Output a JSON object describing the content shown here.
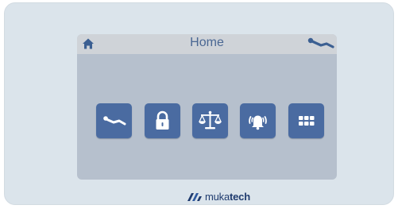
{
  "screen": {
    "title": "Home",
    "tiles": [
      {
        "icon": "recline-icon",
        "name": "recline-button"
      },
      {
        "icon": "lock-icon",
        "name": "lock-button"
      },
      {
        "icon": "scale-icon",
        "name": "scale-button"
      },
      {
        "icon": "alarm-bell-icon",
        "name": "alarm-button"
      },
      {
        "icon": "grid-menu-icon",
        "name": "menu-button"
      }
    ]
  },
  "brand": {
    "name_light": "muka",
    "name_bold": "tech"
  },
  "colors": {
    "device_bg": "#dbe4eb",
    "screen_bg": "#b6c0cd",
    "header_bg": "#cfd3d8",
    "accent": "#4a6ba1",
    "title_text": "#4a6793",
    "brand_text": "#1f3b6e"
  }
}
